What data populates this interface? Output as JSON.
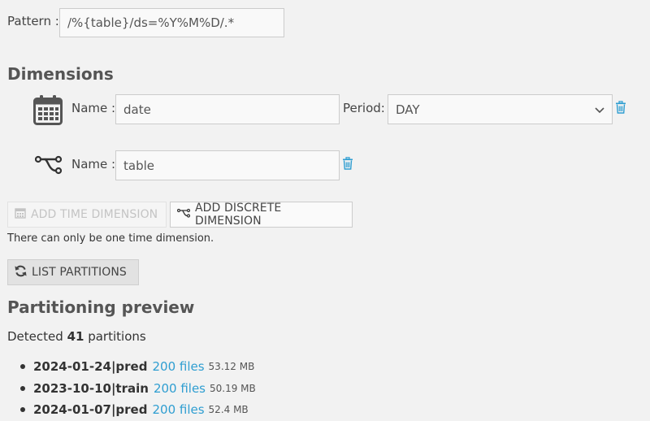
{
  "pattern": {
    "label": "Pattern :",
    "value": "/%{table}/ds=%Y%M%D/.*"
  },
  "dimensions": {
    "heading": "Dimensions",
    "time": {
      "name_label": "Name :",
      "name_value": "date",
      "period_label": "Period:",
      "period_value": "DAY",
      "icon": "calendar-icon"
    },
    "discrete": {
      "name_label": "Name :",
      "name_value": "table",
      "icon": "discrete-branch-icon"
    }
  },
  "buttons": {
    "add_time": "ADD TIME DIMENSION",
    "add_discrete": "ADD DISCRETE DIMENSION",
    "list_partitions": "LIST PARTITIONS"
  },
  "note": "There can only be one time dimension.",
  "preview": {
    "heading": "Partitioning preview",
    "detected_prefix": "Detected",
    "count": "41",
    "detected_suffix": "partitions",
    "partitions": [
      {
        "name": "2024-01-24|pred",
        "files": "200 files",
        "size": "53.12 MB"
      },
      {
        "name": "2023-10-10|train",
        "files": "200 files",
        "size": "50.19 MB"
      },
      {
        "name": "2024-01-07|pred",
        "files": "200 files",
        "size": "52.4 MB"
      }
    ]
  },
  "colors": {
    "accent": "#2f9ed1",
    "background": "#f2f2f2"
  }
}
